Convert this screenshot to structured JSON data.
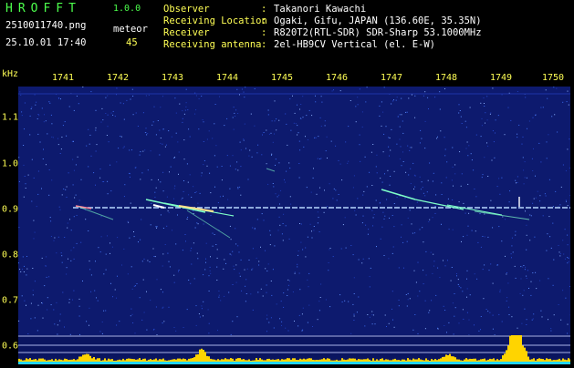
{
  "header": {
    "app_title": "HROFFT",
    "app_version": "1.0.0",
    "filename": "2510011740.png",
    "datetime": "25.10.01 17:40",
    "count_label": "meteor",
    "count_value": "45",
    "info": [
      {
        "label": "Observer",
        "value": "Takanori Kawachi"
      },
      {
        "label": "Receiving Location",
        "value": "Ogaki, Gifu, JAPAN (136.60E, 35.35N)"
      },
      {
        "label": "Receiver",
        "value": "R820T2(RTL-SDR) SDR-Sharp 53.1000MHz"
      },
      {
        "label": "Receiving antenna",
        "value": "2el-HB9CV Vertical (el. E-W)"
      }
    ]
  },
  "axis": {
    "freq_unit": "kHz",
    "time_ticks": [
      "1741",
      "1742",
      "1743",
      "1744",
      "1745",
      "1746",
      "1747",
      "1748",
      "1749",
      "1750"
    ],
    "freq_ticks": [
      "1.1",
      "1.0",
      "0.9",
      "0.8",
      "0.7",
      "0.6"
    ]
  },
  "colors": {
    "background": "#0d1a6e",
    "carrier": "#b8d8ff",
    "meteor": "#7fffc8",
    "histogram": "#ffd400"
  }
}
